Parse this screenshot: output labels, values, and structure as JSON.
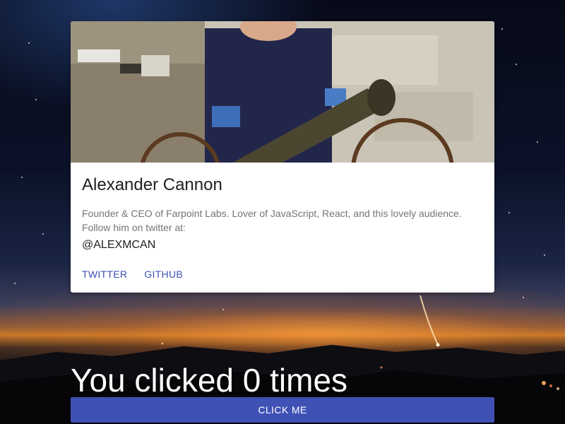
{
  "profile": {
    "name": "Alexander Cannon",
    "description": "Founder & CEO of Farpoint Labs. Lover of JavaScript, React, and this lovely audience. Follow him on twitter at:",
    "handle": "@ALEXMCAN",
    "photo_icon": "profile-photo"
  },
  "actions": {
    "twitter_label": "TWITTER",
    "github_label": "GITHUB"
  },
  "counter": {
    "text": "You clicked 0 times"
  },
  "button": {
    "label": "CLICK ME"
  },
  "colors": {
    "accent": "#3f51b5",
    "card_bg": "#ffffff",
    "title_text": "#212121",
    "desc_text": "#757575"
  }
}
